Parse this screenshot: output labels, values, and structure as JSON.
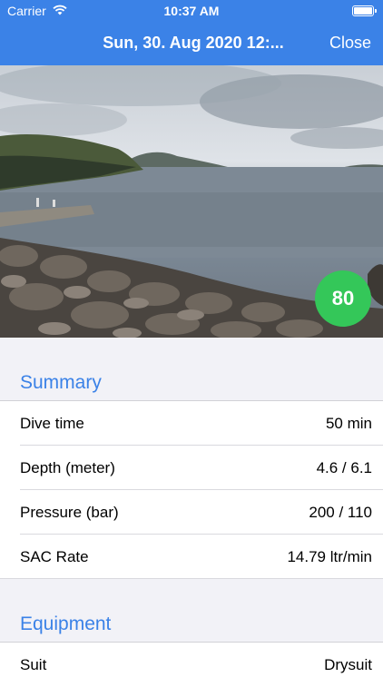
{
  "status": {
    "carrier": "Carrier",
    "time": "10:37 AM"
  },
  "nav": {
    "title": "Sun, 30. Aug 2020 12:...",
    "close": "Close"
  },
  "photo": {
    "score": "80"
  },
  "summary": {
    "title": "Summary",
    "rows": [
      {
        "label": "Dive time",
        "value": "50 min"
      },
      {
        "label": "Depth (meter)",
        "value": "4.6 / 6.1"
      },
      {
        "label": "Pressure (bar)",
        "value": "200 / 110"
      },
      {
        "label": "SAC Rate",
        "value": "14.79 ltr/min"
      }
    ]
  },
  "equipment": {
    "title": "Equipment",
    "rows": [
      {
        "label": "Suit",
        "value": "Drysuit"
      }
    ]
  },
  "colors": {
    "accent": "#3b82e7",
    "score": "#34c759"
  }
}
